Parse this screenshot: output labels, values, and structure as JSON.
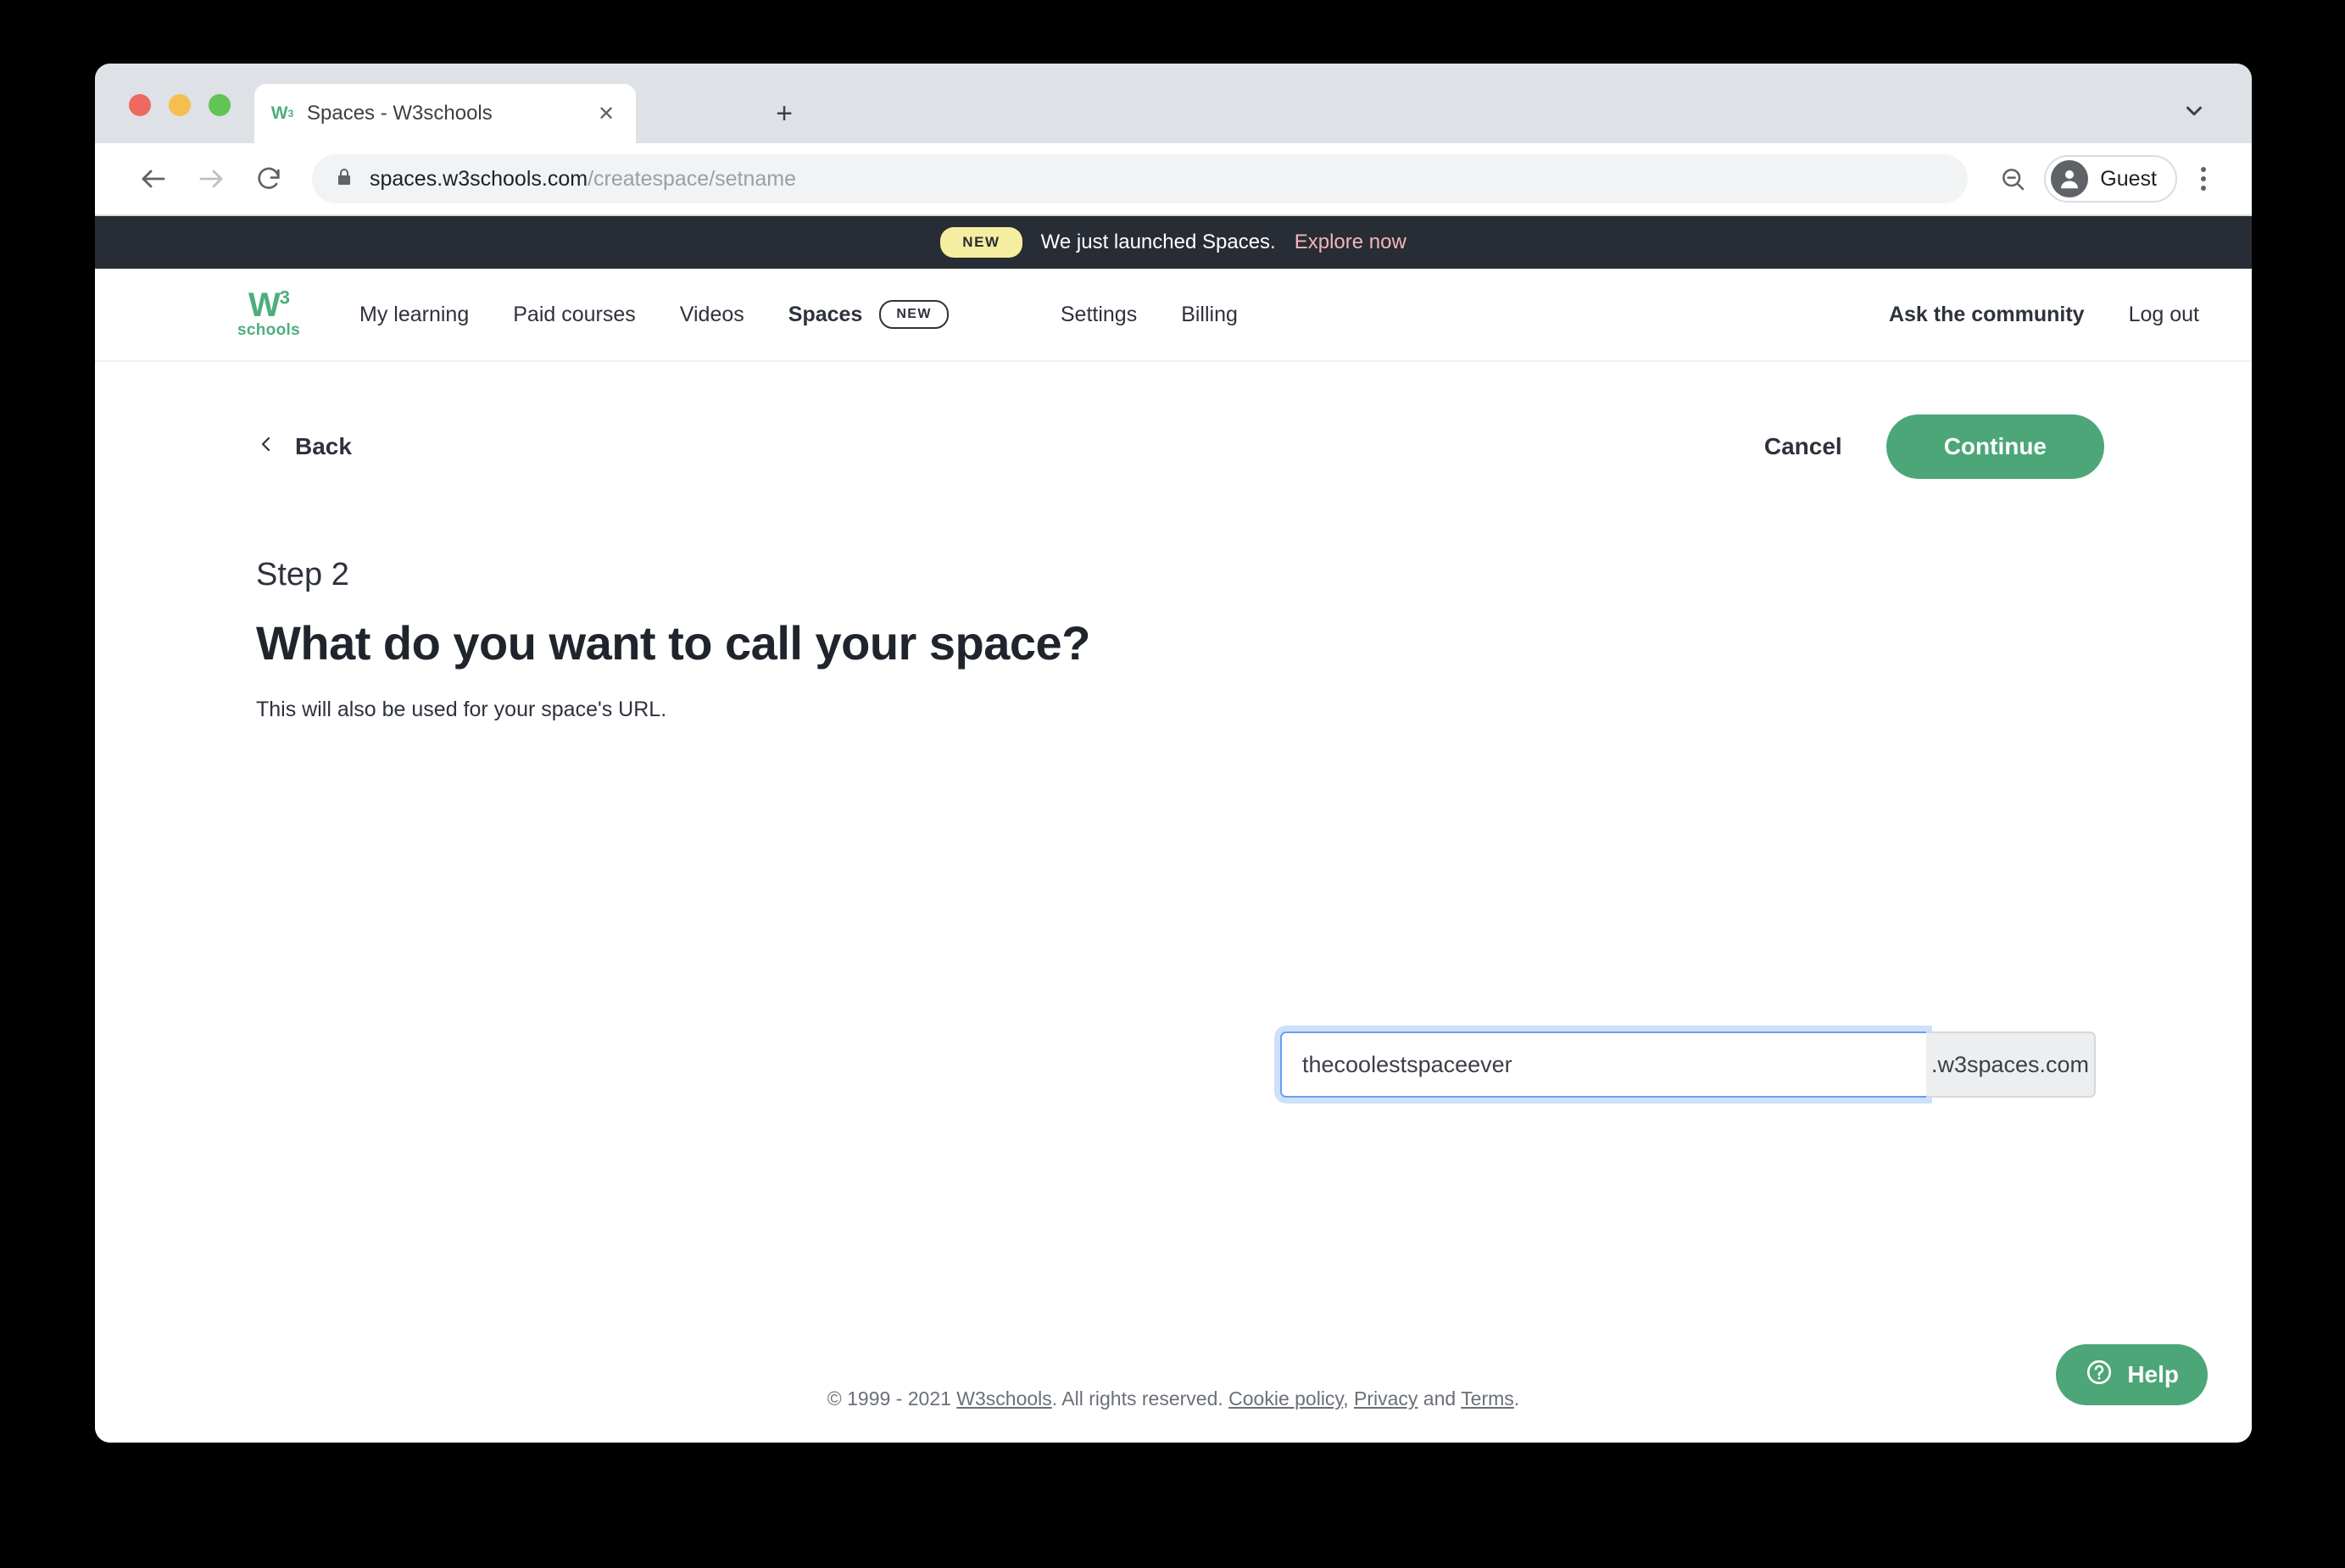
{
  "browser": {
    "tab": {
      "title": "Spaces - W3schools",
      "favicon": "w3-logo-icon",
      "close_icon": "close-icon"
    },
    "new_tab_icon": "plus-icon",
    "tab_search_icon": "chevron-down-icon",
    "back_icon": "arrow-left-icon",
    "forward_icon": "arrow-right-icon",
    "reload_icon": "reload-icon",
    "lock_icon": "lock-icon",
    "url_domain": "spaces.w3schools.com",
    "url_path": "/createspace/setname",
    "zoom_out_icon": "zoom-out-icon",
    "profile_name": "Guest",
    "profile_icon": "person-icon",
    "menu_icon": "kebab-menu-icon"
  },
  "announcement": {
    "badge": "NEW",
    "text": "We just launched Spaces.",
    "link": "Explore now"
  },
  "sitenav": {
    "logo_mark": "W",
    "logo_sup": "3",
    "logo_sub": "schools",
    "items": [
      {
        "label": "My learning",
        "active": false
      },
      {
        "label": "Paid courses",
        "active": false
      },
      {
        "label": "Videos",
        "active": false
      },
      {
        "label": "Spaces",
        "active": true,
        "badge": "NEW"
      },
      {
        "label": "Settings",
        "active": false
      },
      {
        "label": "Billing",
        "active": false
      }
    ],
    "right": [
      {
        "label": "Ask the community",
        "bold": true
      },
      {
        "label": "Log out",
        "bold": false
      }
    ]
  },
  "actions": {
    "back_label": "Back",
    "back_icon": "chevron-left-icon",
    "cancel_label": "Cancel",
    "continue_label": "Continue"
  },
  "form": {
    "step": "Step 2",
    "headline": "What do you want to call your space?",
    "subtext": "This will also be used for your space's URL.",
    "input_value": "thecoolestspaceever",
    "input_placeholder": "",
    "suffix": ".w3spaces.com"
  },
  "footer": {
    "copyright": "© 1999 - 2021 ",
    "brand": "W3schools",
    "rights": ". All rights reserved. ",
    "cookie": "Cookie policy",
    "comma": ", ",
    "privacy": "Privacy",
    "and": " and ",
    "terms": "Terms",
    "period": "."
  },
  "help": {
    "label": "Help",
    "icon": "question-circle-icon"
  },
  "colors": {
    "brand_green": "#4ca678",
    "banner_dark": "#282c34",
    "badge_yellow": "#f5eda0",
    "link_pink": "#f2b6bd",
    "focus_blue": "#6b9ff0"
  }
}
